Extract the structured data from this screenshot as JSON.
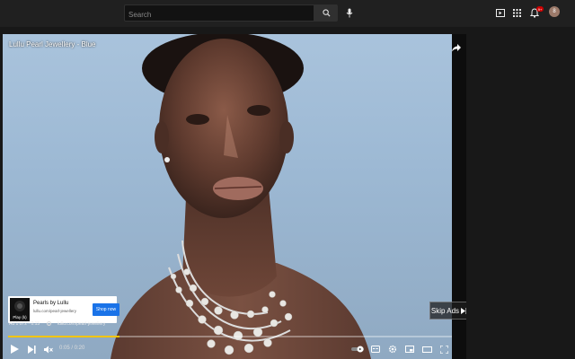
{
  "header": {
    "search_placeholder": "Search",
    "notification_count": "9+",
    "avatar_initial": "8"
  },
  "video": {
    "title": "Lullu Pearl Jewellery - Blue"
  },
  "ad": {
    "card_title": "Pearls by Lullu",
    "card_url": "lullu.com/pearl-jewellery",
    "logo_label": "Play (k)",
    "shop_button": "Shop now",
    "skip_label": "Skip Ads",
    "info_position": "Ad 1 of 2 · 0:15",
    "info_glyph": "i",
    "info_url": "lullu.com/pearl-jewellery",
    "progress_fraction": 0.25
  },
  "player": {
    "time": "0:05 / 0:20"
  },
  "colors": {
    "ad_progress": "#f2c500",
    "shop_button": "#1a73e8",
    "notification_badge": "#cc0000"
  },
  "icons": [
    "search-icon",
    "mic-icon",
    "create-icon",
    "apps-icon",
    "bell-icon",
    "share-icon",
    "play-icon",
    "next-icon",
    "mute-icon",
    "autoplay-toggle",
    "subtitles-icon",
    "settings-icon",
    "miniplayer-icon",
    "theater-icon",
    "fullscreen-icon"
  ]
}
